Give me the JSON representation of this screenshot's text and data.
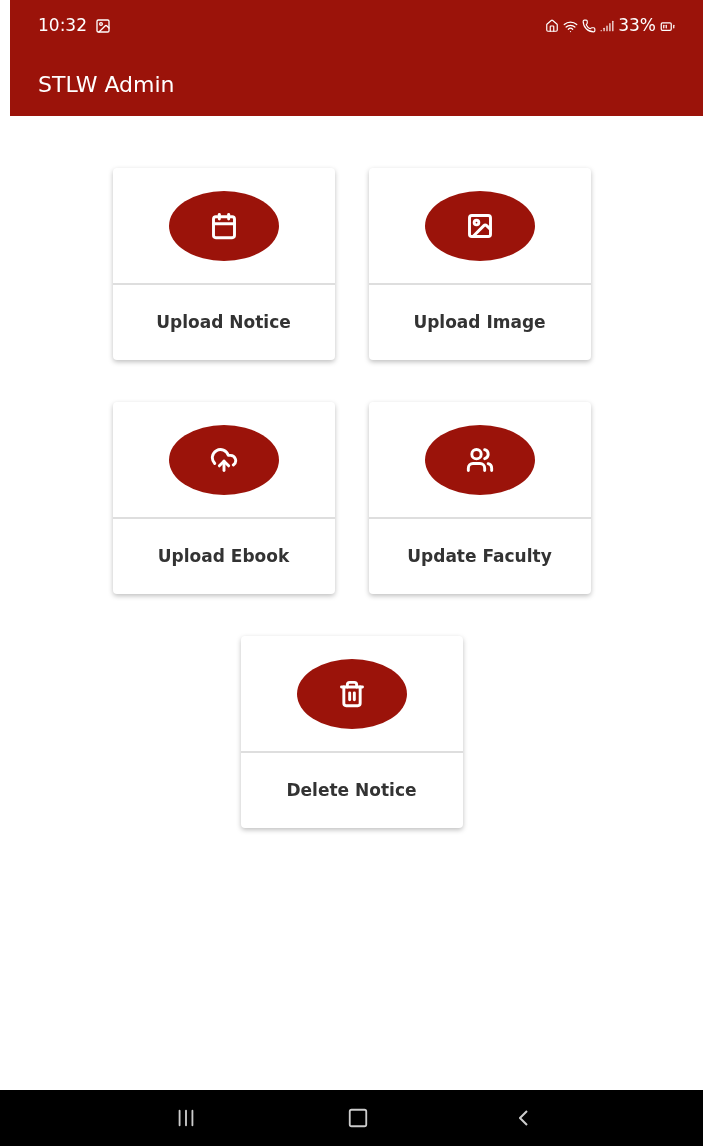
{
  "status_bar": {
    "time": "10:32",
    "battery": "33%"
  },
  "app_bar": {
    "title": "STLW Admin"
  },
  "cards": [
    {
      "kind": "notice",
      "label": "Upload Notice"
    },
    {
      "kind": "image",
      "label": "Upload Image"
    },
    {
      "kind": "ebook",
      "label": "Upload Ebook"
    },
    {
      "kind": "faculty",
      "label": "Update Faculty"
    },
    {
      "kind": "delete",
      "label": "Delete Notice"
    }
  ]
}
